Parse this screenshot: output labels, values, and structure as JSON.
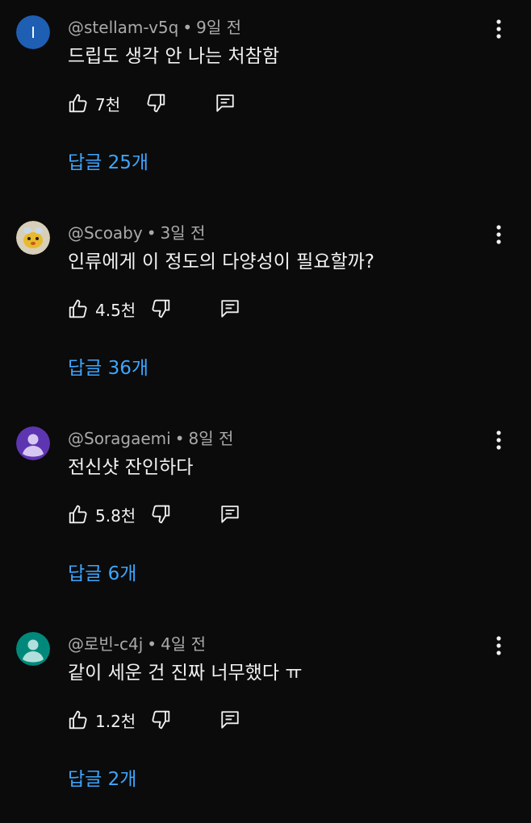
{
  "colors": {
    "background": "#0b0b0b",
    "link": "#3ea6ff",
    "meta": "#aaaaaa",
    "text": "#f1f1f1"
  },
  "comments": [
    {
      "avatar": {
        "type": "letter",
        "letter": "I",
        "bg": "#1e5fb3",
        "icon": "letter-avatar"
      },
      "handle": "@stellam-v5q",
      "time": "9일 전",
      "text": "드립도 생각 안 나는 처참함",
      "likes": "7천",
      "replies": "답글 25개"
    },
    {
      "avatar": {
        "type": "image",
        "bg": "#d8cfb8",
        "icon": "cartoon-avatar"
      },
      "handle": "@Scoaby",
      "time": "3일 전",
      "text": "인류에게 이 정도의 다양성이 필요할까?",
      "likes": "4.5천",
      "replies": "답글 36개"
    },
    {
      "avatar": {
        "type": "default",
        "bg": "#5e35b1",
        "icon": "person-icon"
      },
      "handle": "@Soragaemi",
      "time": "8일 전",
      "text": "전신샷 잔인하다",
      "likes": "5.8천",
      "replies": "답글 6개"
    },
    {
      "avatar": {
        "type": "default",
        "bg": "#00897b",
        "icon": "person-icon"
      },
      "handle": "@로빈-c4j",
      "time": "4일 전",
      "text": "같이 세운 건 진짜 너무했다 ㅠ",
      "likes": "1.2천",
      "replies": "답글 2개"
    }
  ]
}
